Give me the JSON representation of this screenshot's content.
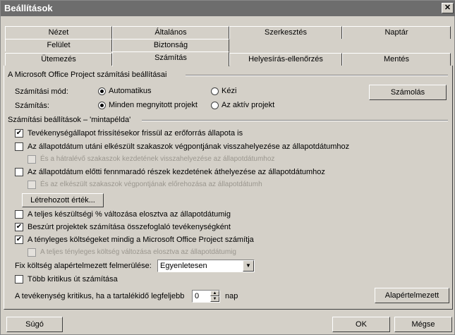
{
  "window": {
    "title": "Beállítások",
    "close_glyph": "✕"
  },
  "tabs_row1": [
    "Nézet",
    "Általános",
    "Szerkesztés",
    "Naptár"
  ],
  "tabs_row2": [
    "Felület",
    "Biztonság"
  ],
  "tabs_row3": [
    "Ütemezés",
    "Számítás",
    "Helyesírás-ellenőrzés",
    "Mentés"
  ],
  "section1": {
    "title": "A Microsoft Office Project számítási beállításai",
    "mode_label": "Számítási mód:",
    "mode_auto": "Automatikus",
    "mode_manual": "Kézi",
    "calc_label": "Számítás:",
    "calc_all": "Minden megnyitott projekt",
    "calc_active": "Az aktív projekt",
    "calc_button": "Számolás"
  },
  "section2": {
    "title": "Számítási beállítások – 'mintapélda'",
    "opt1": "Tevékenységállapot frissítésekor frissül az erőforrás állapota is",
    "opt2": "Az állapotdátum utáni elkészült szakaszok végpontjának visszahelyezése az állapotdátumhoz",
    "opt2a": "És a hátralévő szakaszok kezdetének visszahelyezése az állapotdátumhoz",
    "opt3": "Az állapotdátum előtti fennmaradó részek kezdetének áthelyezése az állapotdátumhoz",
    "opt3a": "És az elkészült szakaszok végpontjának előrehozása az állapotdátumh",
    "earned_button": "Létrehozott érték...",
    "opt4": "A teljes készültségi % változása elosztva az állapotdátumig",
    "opt5": "Beszúrt projektek számítása összefoglaló tevékenységként",
    "opt6": "A tényleges költségeket mindig a Microsoft Office Project számítja",
    "opt6a": "A teljes tényleges költség változása elosztva az állapotdátumig",
    "fixed_cost_label": "Fix költség alapértelmezett felmerülése:",
    "fixed_cost_value": "Egyenletesen",
    "opt7": "Több kritikus út számítása",
    "critical_label": "A tevékenység kritikus, ha a tartalékidő legfeljebb",
    "critical_value": "0",
    "critical_unit": "nap",
    "default_button": "Alapértelmezett"
  },
  "footer": {
    "help": "Súgó",
    "ok": "OK",
    "cancel": "Mégse"
  },
  "checks": {
    "check": "✔",
    "dropdown": "▼",
    "up": "▲",
    "down": "▼"
  }
}
